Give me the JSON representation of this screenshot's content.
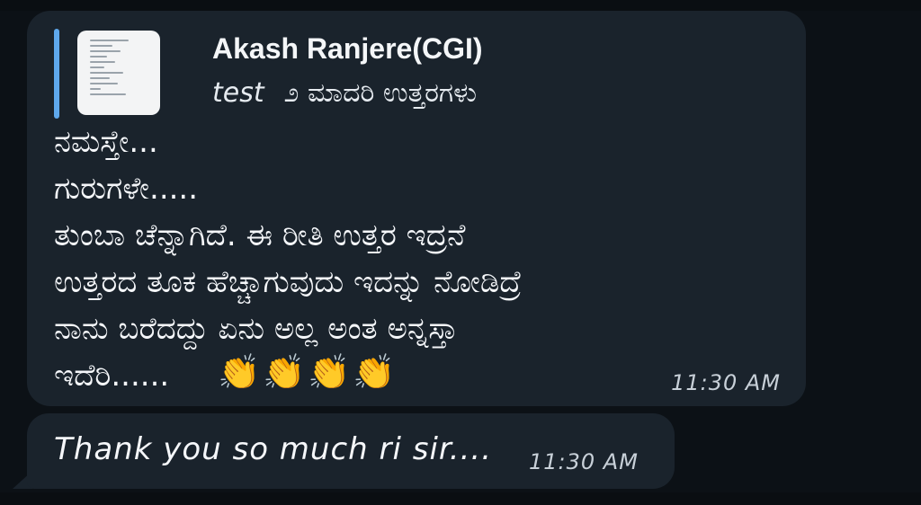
{
  "colors": {
    "background": "#0c1116",
    "bubble": "#1a232c",
    "reply_bar": "#5ea8ec",
    "text": "#f5f7fa",
    "timestamp": "#c8d0d8"
  },
  "message_1": {
    "reply": {
      "sender": "Akash Ranjere(CGI)",
      "prefix": "test",
      "text": "೨ ಮಾದರಿ ಉತ್ತರಗಳು",
      "thumbnail_icon": "document-thumbnail-icon"
    },
    "body": "ನಮಸ್ತೇ...\n ಗುರುಗಳೇ.....\nತುಂಬಾ ಚೆನ್ನಾಗಿದೆ. ಈ ರೀತಿ ಉತ್ತರ ಇದ್ರನೆ\nಉತ್ತರದ ತೂಕ ಹೆಚ್ಚಾಗುವುದು ಇದನ್ನು ನೋಡಿದ್ರೆ\nನಾನು ಬರೆದದ್ದು ಏನು ಅಲ್ಲ ಅಂತ ಅನ್ನಸ್ತಾ\nಇದೆರಿ......",
    "emojis": [
      "👏",
      "👏",
      "👏",
      "👏"
    ],
    "time": "11:30 AM"
  },
  "message_2": {
    "text": "Thank you so much ri sir....",
    "time": "11:30 AM"
  }
}
